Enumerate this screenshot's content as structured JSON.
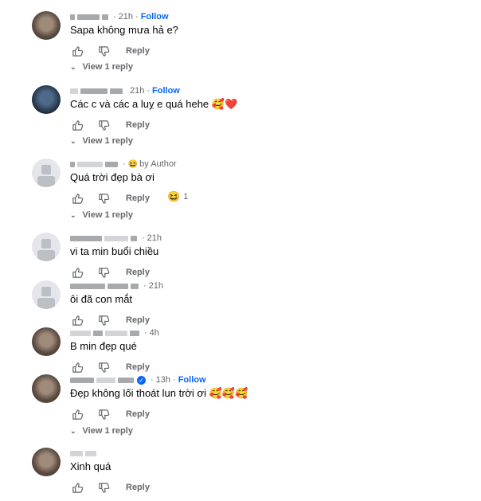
{
  "labels": {
    "follow": "Follow",
    "reply": "Reply",
    "view_reply": "View 1 reply",
    "by_author": "by Author"
  },
  "comments": [
    {
      "time": "21h",
      "text": "Sapa không mưa hả e?",
      "follow": true
    },
    {
      "time": "21h",
      "text": "Các c và các a luỵ e quá hehe 🥰❤️",
      "follow": true
    },
    {
      "time": "",
      "text": "Quá trời đẹp bà ơi",
      "author": true,
      "author_emoji": "😆",
      "reaction_emoji": "😆",
      "reaction_count": "1"
    },
    {
      "time": "21h",
      "text": "vi ta min buổi chiều"
    },
    {
      "time": "21h",
      "text": "ôi đã con mắt"
    },
    {
      "time": "4h",
      "text": "B min đẹp qué"
    },
    {
      "time": "13h",
      "text": "Đẹp không lối thoát lun trời ơi 🥰🥰🥰",
      "follow": true,
      "verified": true
    },
    {
      "time": "",
      "text": "Xinh quá"
    }
  ],
  "colors": {
    "accent": "#0866ff",
    "secondary_text": "#65676b",
    "primary_text": "#050505"
  }
}
